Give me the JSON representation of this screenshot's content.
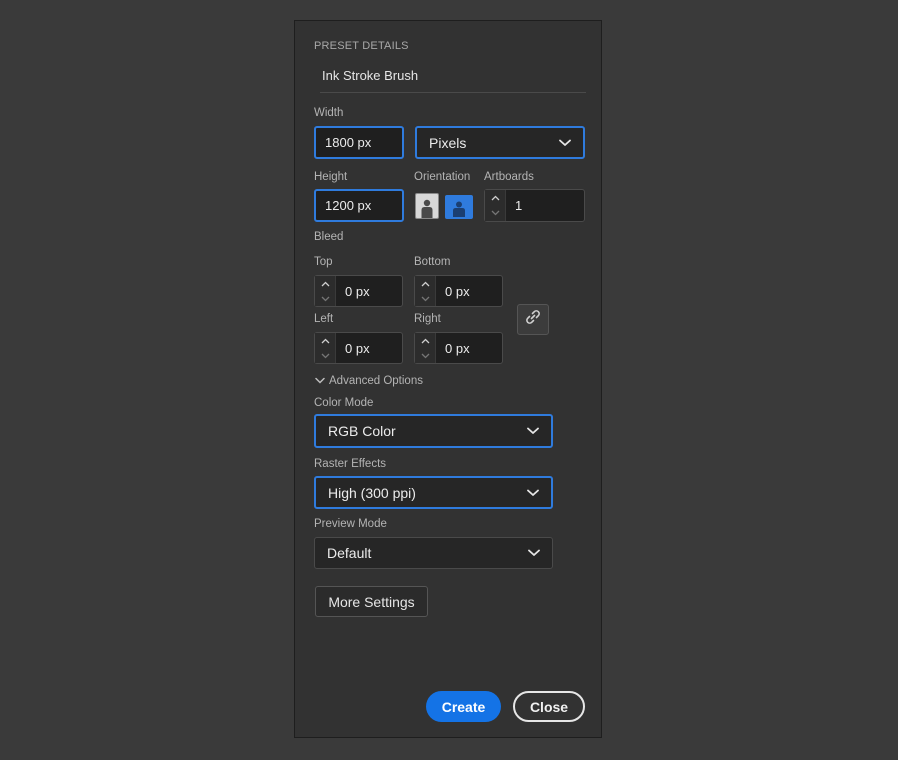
{
  "preset": {
    "section_title": "PRESET DETAILS",
    "name": "Ink Stroke Brush"
  },
  "width": {
    "label": "Width",
    "value": "1800 px",
    "units": "Pixels"
  },
  "height": {
    "label": "Height",
    "value": "1200 px"
  },
  "orientation": {
    "label": "Orientation",
    "selected": "landscape"
  },
  "artboards": {
    "label": "Artboards",
    "value": "1"
  },
  "bleed": {
    "label": "Bleed",
    "top_label": "Top",
    "top_value": "0 px",
    "bottom_label": "Bottom",
    "bottom_value": "0 px",
    "left_label": "Left",
    "left_value": "0 px",
    "right_label": "Right",
    "right_value": "0 px",
    "link_icon": "link-icon"
  },
  "advanced": {
    "toggle_label": "Advanced Options",
    "color_mode_label": "Color Mode",
    "color_mode_value": "RGB Color",
    "raster_label": "Raster Effects",
    "raster_value": "High (300 ppi)",
    "preview_label": "Preview Mode",
    "preview_value": "Default"
  },
  "buttons": {
    "more_settings": "More Settings",
    "create": "Create",
    "close": "Close"
  },
  "colors": {
    "accent": "#1473e6",
    "focus_border": "#2f7bdd",
    "panel_bg": "#323232",
    "page_bg": "#3a3a3a"
  }
}
